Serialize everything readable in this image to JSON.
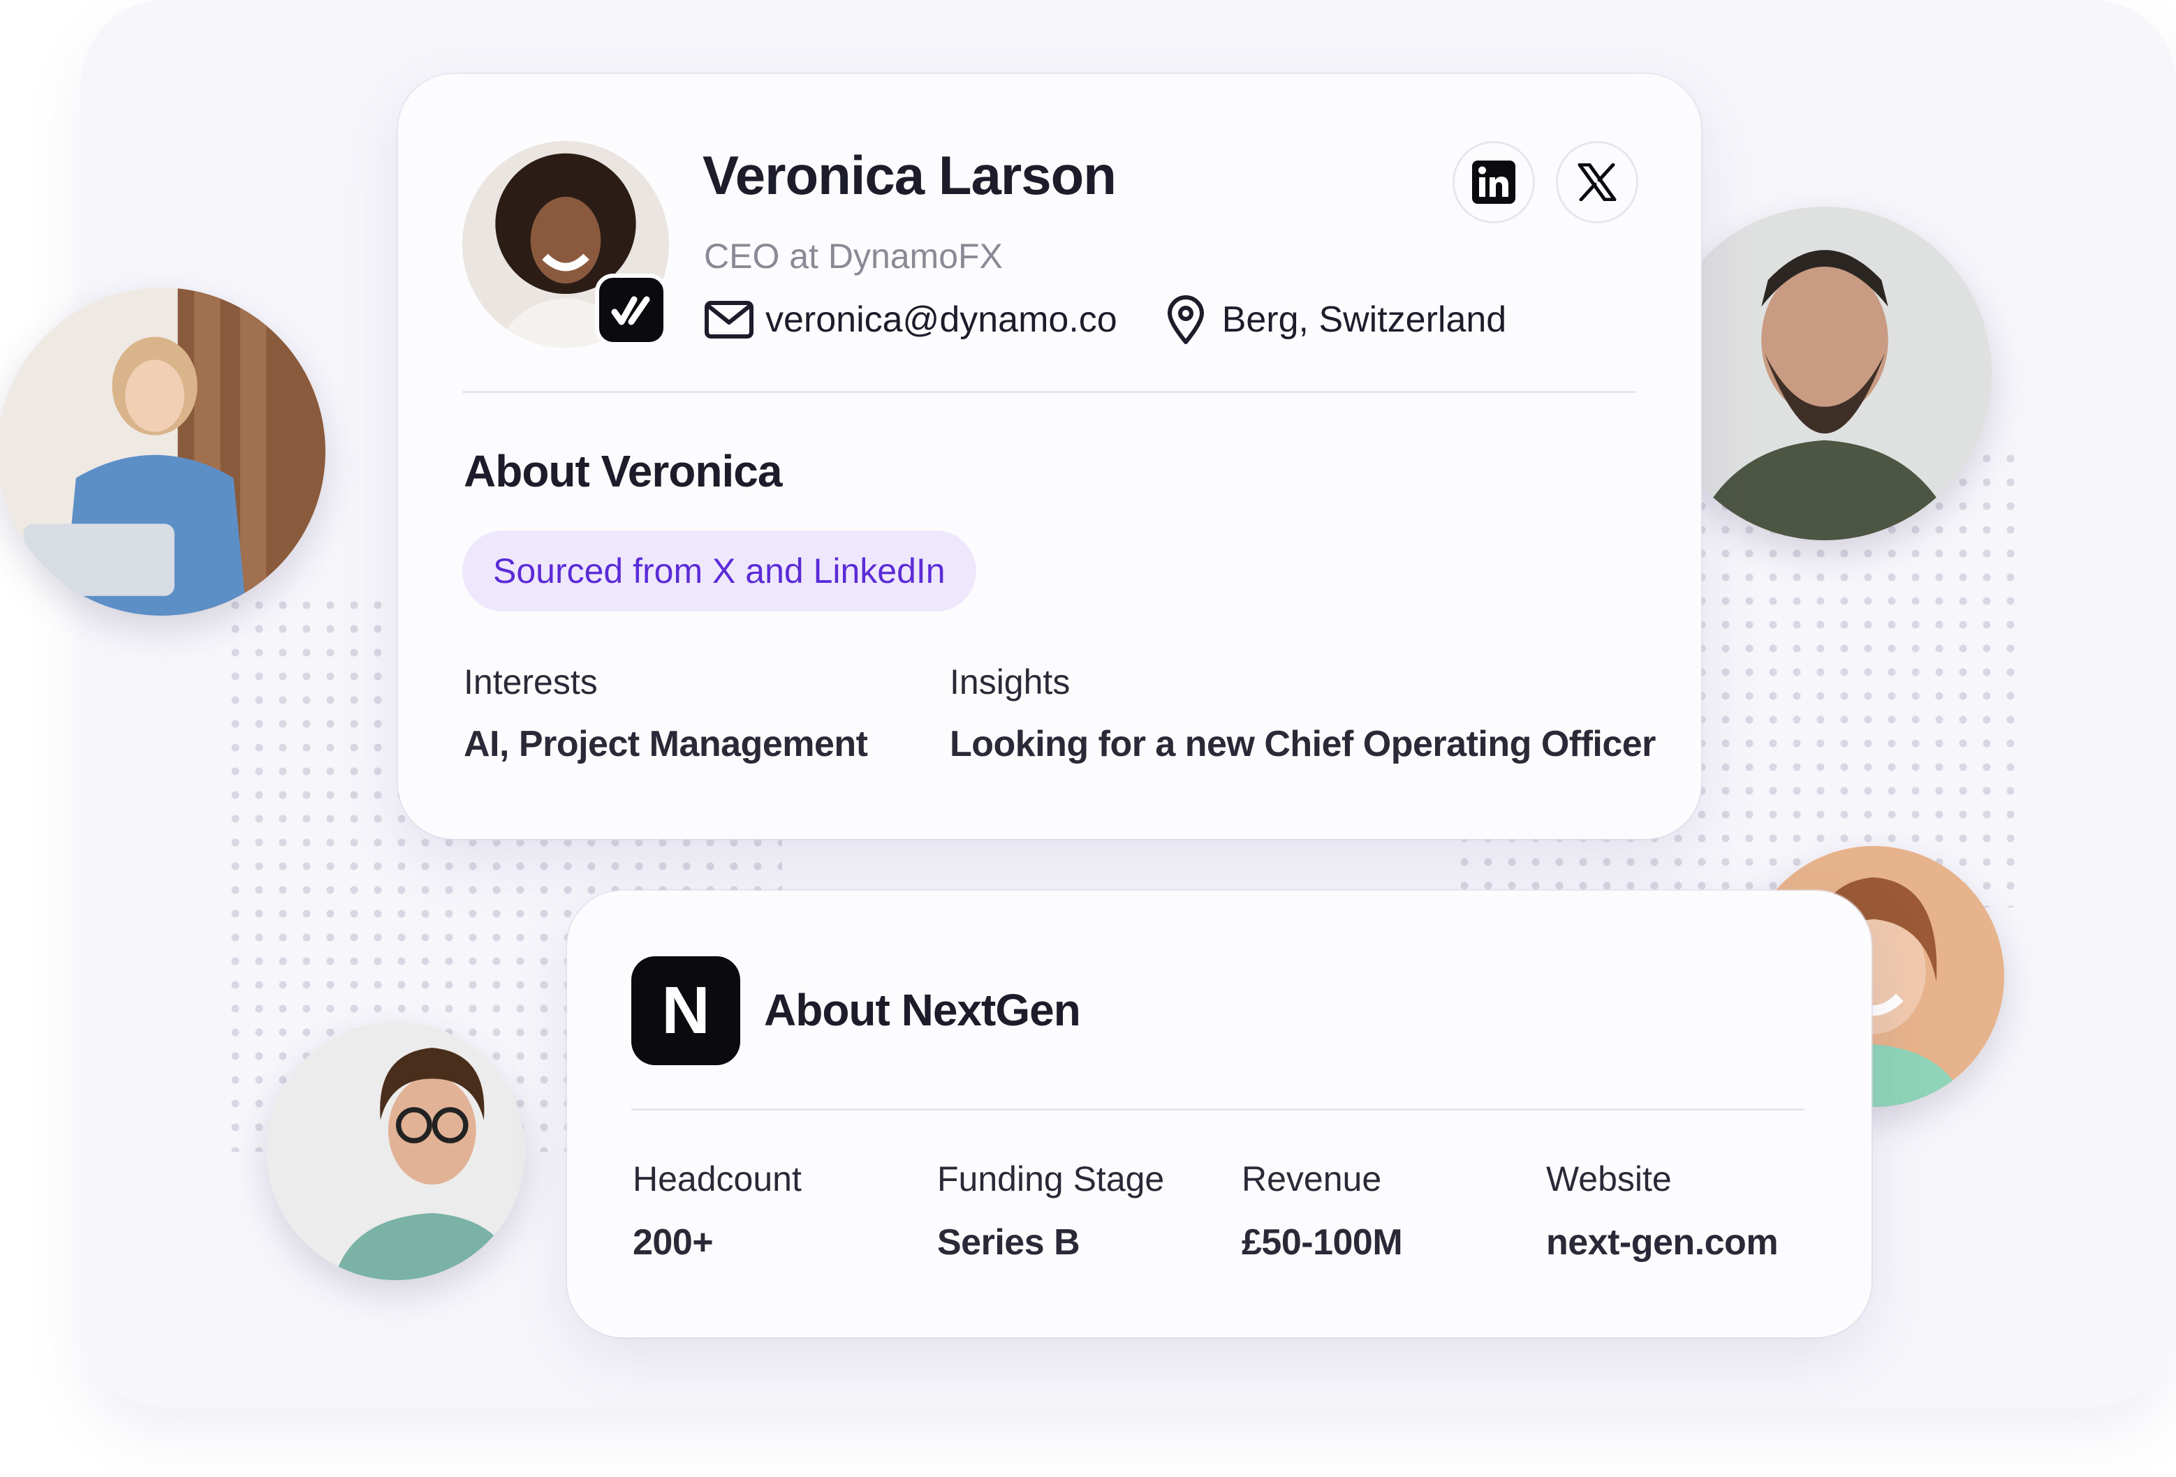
{
  "profile": {
    "name": "Veronica Larson",
    "role": "CEO at DynamoFX",
    "email": "veronica@dynamo.co",
    "location": "Berg, Switzerland",
    "avatar_icon": "woman-curly-hair-avatar",
    "verified_badge_icon": "check-badge-icon"
  },
  "social": {
    "linkedin_icon": "linkedin-icon",
    "x_icon": "x-icon"
  },
  "about": {
    "title": "About Veronica",
    "source_pill": "Sourced from X and LinkedIn",
    "interests_label": "Interests",
    "interests_value": "AI, Project Management",
    "insights_label": "Insights",
    "insights_value": "Looking for a new Chief Operating Officer"
  },
  "company": {
    "logo_letter": "N",
    "title": "About NextGen",
    "fields": [
      {
        "label": "Headcount",
        "value": "200+"
      },
      {
        "label": "Funding Stage",
        "value": "Series B"
      },
      {
        "label": "Revenue",
        "value": "£50-100M"
      },
      {
        "label": "Website",
        "value": "next-gen.com"
      }
    ]
  },
  "colors": {
    "accent": "#5b2bd6",
    "pill_bg": "#efe8fd",
    "background": "#f7f6fb",
    "text": "#1d1c2b",
    "muted": "#8a8995"
  }
}
